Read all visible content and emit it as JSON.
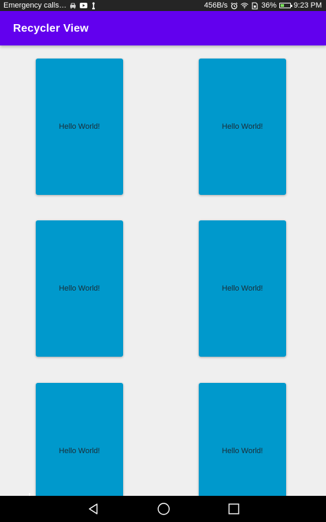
{
  "status_bar": {
    "carrier_text": "Emergency calls…",
    "network_speed": "456B/s",
    "battery_percent": "36%",
    "battery_level": 0.36,
    "time": "9:23 PM",
    "left_icons": [
      "car-icon",
      "youtube-icon",
      "usb-icon"
    ],
    "right_icons": [
      "alarm-icon",
      "wifi-icon",
      "sim-icon",
      "battery-icon"
    ]
  },
  "app_bar": {
    "title": "Recycler View",
    "color": "#6200ee"
  },
  "recycler": {
    "card_color": "#0099cc",
    "items": [
      {
        "label": "Hello World!"
      },
      {
        "label": "Hello World!"
      },
      {
        "label": "Hello World!"
      },
      {
        "label": "Hello World!"
      },
      {
        "label": "Hello World!"
      },
      {
        "label": "Hello World!"
      }
    ]
  },
  "nav_bar": {
    "buttons": [
      "back-icon",
      "home-icon",
      "recents-icon"
    ]
  }
}
